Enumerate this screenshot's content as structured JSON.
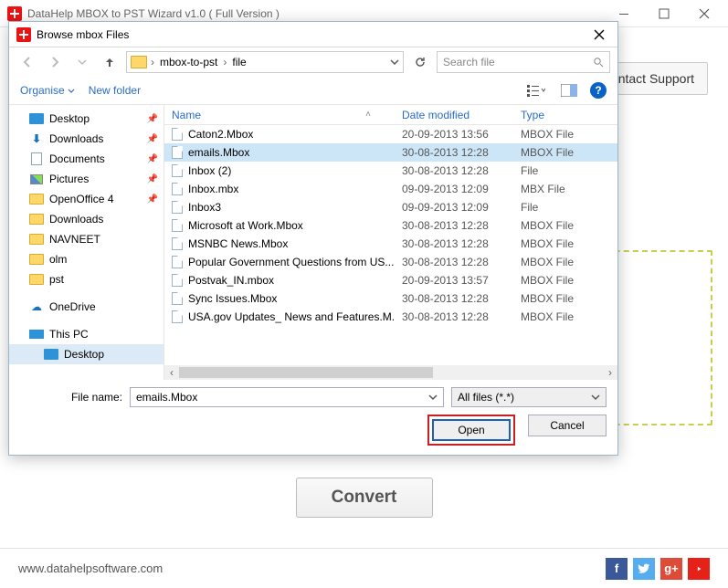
{
  "app": {
    "title": "DataHelp MBOX to PST Wizard v1.0 ( Full Version )",
    "support_button": "ontact Support",
    "convert_button": "Convert",
    "footer_url": "www.datahelpsoftware.com"
  },
  "dialog": {
    "title": "Browse mbox Files",
    "breadcrumb": [
      "mbox-to-pst",
      "file"
    ],
    "search_placeholder": "Search file",
    "organise_label": "Organise",
    "new_folder_label": "New folder",
    "columns": {
      "name": "Name",
      "date": "Date modified",
      "type": "Type"
    },
    "tree": [
      {
        "label": "Desktop",
        "icon": "desktop",
        "pinned": true
      },
      {
        "label": "Downloads",
        "icon": "download",
        "pinned": true
      },
      {
        "label": "Documents",
        "icon": "doc",
        "pinned": true
      },
      {
        "label": "Pictures",
        "icon": "pic",
        "pinned": true
      },
      {
        "label": "OpenOffice 4",
        "icon": "folder",
        "pinned": true
      },
      {
        "label": "Downloads",
        "icon": "folder",
        "pinned": false
      },
      {
        "label": "NAVNEET",
        "icon": "folder",
        "pinned": false
      },
      {
        "label": "olm",
        "icon": "folder",
        "pinned": false
      },
      {
        "label": "pst",
        "icon": "folder",
        "pinned": false
      },
      {
        "label": "",
        "icon": "spacer",
        "pinned": false
      },
      {
        "label": "OneDrive",
        "icon": "onedrive",
        "pinned": false
      },
      {
        "label": "",
        "icon": "spacer",
        "pinned": false
      },
      {
        "label": "This PC",
        "icon": "thispc",
        "pinned": false
      },
      {
        "label": "Desktop",
        "icon": "desktop",
        "pinned": false,
        "level": 2,
        "selected": true
      }
    ],
    "files": [
      {
        "name": "Caton2.Mbox",
        "date": "20-09-2013 13:56",
        "type": "MBOX File",
        "selected": false
      },
      {
        "name": "emails.Mbox",
        "date": "30-08-2013 12:28",
        "type": "MBOX File",
        "selected": true
      },
      {
        "name": "Inbox (2)",
        "date": "30-08-2013 12:28",
        "type": "File",
        "selected": false
      },
      {
        "name": "Inbox.mbx",
        "date": "09-09-2013 12:09",
        "type": "MBX File",
        "selected": false
      },
      {
        "name": "Inbox3",
        "date": "09-09-2013 12:09",
        "type": "File",
        "selected": false
      },
      {
        "name": "Microsoft at Work.Mbox",
        "date": "30-08-2013 12:28",
        "type": "MBOX File",
        "selected": false
      },
      {
        "name": "MSNBC News.Mbox",
        "date": "30-08-2013 12:28",
        "type": "MBOX File",
        "selected": false
      },
      {
        "name": "Popular Government Questions from US...",
        "date": "30-08-2013 12:28",
        "type": "MBOX File",
        "selected": false
      },
      {
        "name": "Postvak_IN.mbox",
        "date": "20-09-2013 13:57",
        "type": "MBOX File",
        "selected": false
      },
      {
        "name": "Sync Issues.Mbox",
        "date": "30-08-2013 12:28",
        "type": "MBOX File",
        "selected": false
      },
      {
        "name": "USA.gov Updates_ News and Features.M...",
        "date": "30-08-2013 12:28",
        "type": "MBOX File",
        "selected": false
      }
    ],
    "file_name_label": "File name:",
    "file_name_value": "emails.Mbox",
    "filter_value": "All files (*.*)",
    "open_label": "Open",
    "cancel_label": "Cancel"
  },
  "social": {
    "fb": "f",
    "tw": "",
    "gp": "g+",
    "yt": ""
  }
}
